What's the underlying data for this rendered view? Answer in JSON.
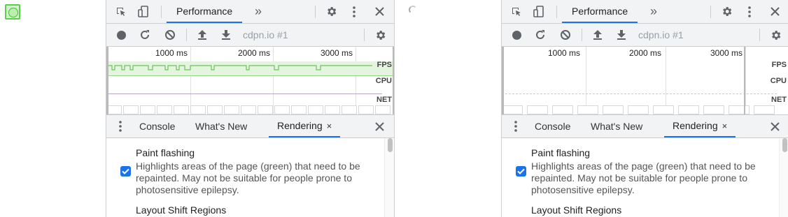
{
  "panels": [
    {
      "tabs": {
        "main": "Performance",
        "more": "»"
      },
      "recording": {
        "url": "cdpn.io #1"
      },
      "timeline": {
        "ticks": [
          "1000 ms",
          "2000 ms",
          "3000 ms"
        ],
        "tracks": {
          "fps": "FPS",
          "cpu": "CPU",
          "net": "NET"
        },
        "fps_active": true
      },
      "drawer": {
        "tabs": [
          "Console",
          "What's New",
          "Rendering"
        ],
        "close_tab": "×",
        "close_drawer": "✕"
      },
      "rendering": {
        "paint_flashing": {
          "title": "Paint flashing",
          "description": "Highlights areas of the page (green) that need to be repainted. May not be suitable for people prone to photosensitive epilepsy.",
          "checked": true
        },
        "layout_shift": {
          "title": "Layout Shift Regions"
        }
      }
    },
    {
      "tabs": {
        "main": "Performance",
        "more": "»"
      },
      "recording": {
        "url": "cdpn.io #1"
      },
      "timeline": {
        "ticks": [
          "1000 ms",
          "2000 ms",
          "3000 ms"
        ],
        "tracks": {
          "fps": "FPS",
          "cpu": "CPU",
          "net": "NET"
        },
        "fps_active": false
      },
      "drawer": {
        "tabs": [
          "Console",
          "What's New",
          "Rendering"
        ],
        "close_tab": "×",
        "close_drawer": "✕"
      },
      "rendering": {
        "paint_flashing": {
          "title": "Paint flashing",
          "description": "Highlights areas of the page (green) that need to be repainted. May not be suitable for people prone to photosensitive epilepsy.",
          "checked": true
        },
        "layout_shift": {
          "title": "Layout Shift Regions"
        }
      }
    }
  ],
  "colors": {
    "accent": "#1a73e8",
    "paint_flash": "#5ad04a",
    "fps_fill": "#e4f5df"
  }
}
